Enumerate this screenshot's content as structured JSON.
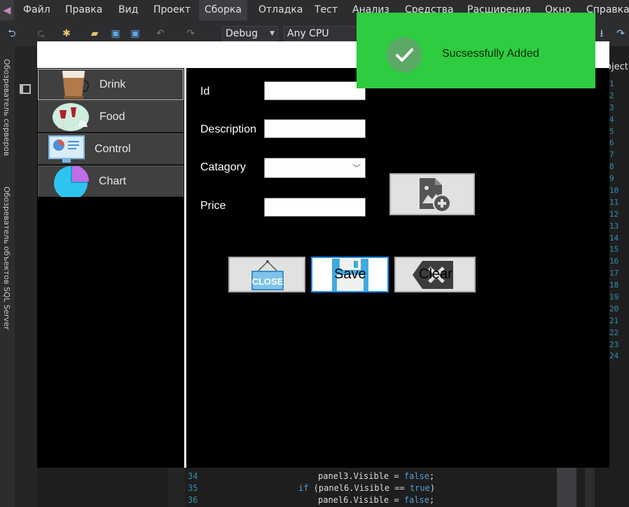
{
  "vs": {
    "menu": [
      "Файл",
      "Правка",
      "Вид",
      "Проект",
      "Сборка",
      "Отладка",
      "Тест",
      "Анализ",
      "Средства",
      "Расширения",
      "Окно",
      "Справка"
    ],
    "config": "Debug",
    "platform": "Any CPU",
    "side_tab_1": "Обозреватель серверов",
    "side_tab_2": "Обозреватель объектов SQL Server",
    "right_panel_label": "roject",
    "line_numbers": [
      "1",
      "2",
      "3",
      "4",
      "5",
      "6",
      "7",
      "8",
      "9",
      "10",
      "11",
      "12",
      "13",
      "14",
      "15",
      "16",
      "17",
      "18",
      "19",
      "20",
      "21",
      "22",
      "23",
      "24"
    ],
    "code": {
      "line1": {
        "num": "34",
        "code": "panel3.Visible = false;"
      },
      "line2": {
        "num": "35",
        "code": "if (panel6.Visible == true)"
      },
      "line3": {
        "num": "36",
        "code": "panel6.Visible = false;"
      }
    }
  },
  "app": {
    "sidebar": {
      "drink": "Drink",
      "food": "Food",
      "control": "Control",
      "chart": "Chart"
    },
    "form": {
      "id_label": "Id",
      "description_label": "Description",
      "category_label": "Catagory",
      "price_label": "Price",
      "id_value": "",
      "description_value": "",
      "category_value": "",
      "price_value": ""
    },
    "buttons": {
      "close_image_text": "CLOSE",
      "save": "Save",
      "clear": "Clear"
    }
  },
  "toast": {
    "message": "Sucsessfully Added",
    "color": "#2ecc40"
  }
}
